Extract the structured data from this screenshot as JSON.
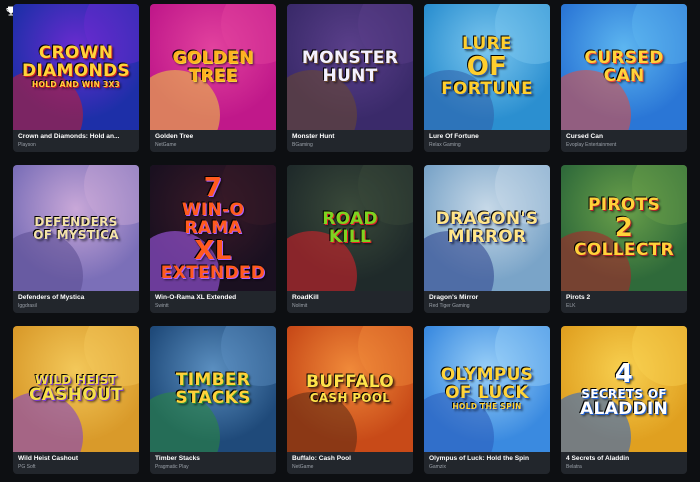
{
  "header": {
    "icon": "trophy-icon"
  },
  "games": [
    {
      "name": "Crown and Diamonds: Hold an...",
      "provider": "Playson",
      "logo_lines": [
        "CROWN",
        "DIAMONDS",
        "HOLD AND WIN 3x3"
      ],
      "bg": "#1d2fa8",
      "bg2": "#6a2bd0",
      "logo_color": "#ffd23a",
      "accent": "#c81e2a"
    },
    {
      "name": "Golden Tree",
      "provider": "NetGame",
      "logo_lines": [
        "GOLDEN",
        "TREE"
      ],
      "bg": "#c0188a",
      "bg2": "#e2429e",
      "logo_color": "#ffb020",
      "accent": "#f0d23c"
    },
    {
      "name": "Monster Hunt",
      "provider": "BGaming",
      "logo_lines": [
        "Monster",
        "Hunt"
      ],
      "bg": "#3a2a6a",
      "bg2": "#5a3f8a",
      "logo_color": "#f4f1ff",
      "accent": "#6b4a2e"
    },
    {
      "name": "Lure Of Fortune",
      "provider": "Relax Gaming",
      "logo_lines": [
        "LURE",
        "OF",
        "FORTUNE"
      ],
      "bg": "#2b8fd0",
      "bg2": "#7cc7ef",
      "logo_color": "#ffcf2e",
      "accent": "#2f5ea8"
    },
    {
      "name": "Cursed Can",
      "provider": "Evoplay Entertainment",
      "logo_lines": [
        "CURSED",
        "CAN"
      ],
      "bg": "#2a76d6",
      "bg2": "#5db6f0",
      "logo_color": "#ffd43a",
      "accent": "#e84a3a"
    },
    {
      "name": "Defenders of Mystica",
      "provider": "Iggdrasil",
      "logo_lines": [
        "DEFENDERS",
        "OF MYSTICA"
      ],
      "bg": "#7b6fb8",
      "bg2": "#c9a8d8",
      "logo_color": "#f4e3a8",
      "accent": "#5a4b8f"
    },
    {
      "name": "Win-O-Rama XL Extended",
      "provider": "Swintt",
      "logo_lines": [
        "7",
        "WIN-O",
        "RAMA",
        "XL",
        "extended"
      ],
      "bg": "#1a1020",
      "bg2": "#3a1a28",
      "logo_color": "#ff5a1e",
      "accent": "#b060ff"
    },
    {
      "name": "RoadKill",
      "provider": "Nolimit",
      "logo_lines": [
        "ROAD",
        "KILL"
      ],
      "bg": "#1f2a2a",
      "bg2": "#3a4a3a",
      "logo_color": "#7ed321",
      "accent": "#e0202a"
    },
    {
      "name": "Dragon's Mirror",
      "provider": "Red Tiger Gaming",
      "logo_lines": [
        "DRAGON'S",
        "MIRROR"
      ],
      "bg": "#7aa4c8",
      "bg2": "#c7d9e8",
      "logo_color": "#ffe58a",
      "accent": "#2b3f8a"
    },
    {
      "name": "Pirots 2",
      "provider": "ELK",
      "logo_lines": [
        "PIROTS",
        "2",
        "CollectR"
      ],
      "bg": "#2f6a3a",
      "bg2": "#6aa04a",
      "logo_color": "#ffd23a",
      "accent": "#b0202a"
    },
    {
      "name": "Wild Heist Cashout",
      "provider": "PG Soft",
      "logo_lines": [
        "WILD HEIST",
        "CASHOUT"
      ],
      "bg": "#d99a2a",
      "bg2": "#f3c85a",
      "logo_color": "#f6e04a",
      "accent": "#7a3ad0"
    },
    {
      "name": "Timber Stacks",
      "provider": "Pragmatic Play",
      "logo_lines": [
        "TIMBER",
        "STACKS"
      ],
      "bg": "#1f4a7a",
      "bg2": "#5b8fc0",
      "logo_color": "#ffd23a",
      "accent": "#2a8a3a"
    },
    {
      "name": "Buffalo: Cash Pool",
      "provider": "NetGame",
      "logo_lines": [
        "BUFFALO",
        "CASH POOL"
      ],
      "bg": "#c84a18",
      "bg2": "#f08a3a",
      "logo_color": "#ffe24a",
      "accent": "#5a2a14"
    },
    {
      "name": "Olympus of Luck: Hold the Spin",
      "provider": "Gamzix",
      "logo_lines": [
        "OLYMPUS",
        "OF LUCK",
        "HOLD THE SPIN"
      ],
      "bg": "#3a8ae0",
      "bg2": "#9ad0f8",
      "logo_color": "#ffd43a",
      "accent": "#2a5ab8"
    },
    {
      "name": "4 Secrets of Aladdin",
      "provider": "Belatra",
      "logo_lines": [
        "4",
        "secrets of",
        "ALADDIN"
      ],
      "bg": "#e0a020",
      "bg2": "#f8d050",
      "logo_color": "#ffffff",
      "accent": "#2060d0"
    }
  ]
}
